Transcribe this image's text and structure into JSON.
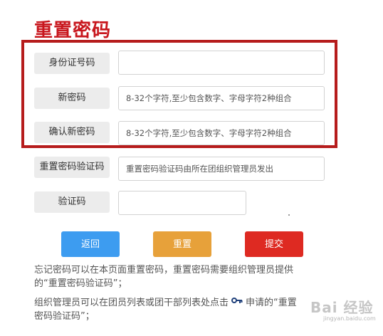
{
  "page": {
    "title": "重置密码"
  },
  "form": {
    "id_number": {
      "label": "身份证号码",
      "value": "",
      "placeholder": ""
    },
    "new_password": {
      "label": "新密码",
      "value": "",
      "placeholder": "8-32个字符,至少包含数字、字母字符2种组合"
    },
    "confirm_password": {
      "label": "确认新密码",
      "value": "",
      "placeholder": "8-32个字符,至少包含数字、字母字符2种组合"
    },
    "reset_code": {
      "label": "重置密码验证码",
      "value": "",
      "placeholder": "重置密码验证码由所在团组织管理员发出"
    },
    "captcha": {
      "label": "验证码",
      "value": "",
      "placeholder": ""
    }
  },
  "buttons": {
    "back": {
      "label": "返回",
      "color": "#3d9cf0"
    },
    "reset": {
      "label": "重置",
      "color": "#e7a13a"
    },
    "submit": {
      "label": "提交",
      "color": "#de2a22"
    }
  },
  "notes": {
    "note1_line1": "忘记密码可以在本页面重置密码，重置密码需要组织管理员提供",
    "note1_line2": "的“重置密码验证码”；",
    "note2_part1": "组织管理员可以在团员列表或团干部列表处点击",
    "note2_part2": "申请的“重置",
    "note2_line2": "密码验证码”；"
  },
  "icons": {
    "key": "key-icon"
  },
  "watermark": {
    "text": "Bai 经验",
    "url": "jingyan.baidu.com"
  },
  "colors": {
    "title": "#c8161d",
    "highlight_border": "#b61c1c"
  }
}
